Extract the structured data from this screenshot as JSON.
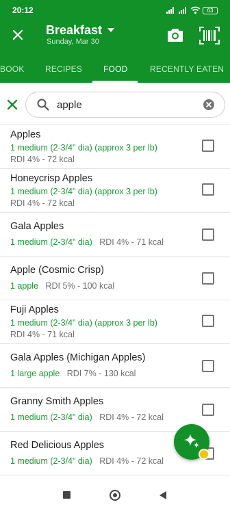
{
  "status_bar": {
    "time": "20:12",
    "battery": "63"
  },
  "header": {
    "title": "Breakfast",
    "date": "Sunday, Mar 30"
  },
  "tabs": [
    {
      "label": "BOOK"
    },
    {
      "label": "RECIPES"
    },
    {
      "label": "FOOD",
      "active": true
    },
    {
      "label": "RECENTLY EATEN"
    }
  ],
  "search": {
    "value": "apple"
  },
  "results": [
    {
      "name": "Apples",
      "serving": "1 medium (2-3/4\" dia) (approx 3 per lb)",
      "nutrition": "RDI 4% - 72 kcal"
    },
    {
      "name": "Honeycrisp Apples",
      "serving": "1 medium  (2-3/4\" dia) (approx 3 per lb)",
      "nutrition": "RDI 4% - 72 kcal"
    },
    {
      "name": "Gala Apples",
      "serving": "1 medium  (2-3/4\" dia)",
      "nutrition": "RDI 4% - 71 kcal"
    },
    {
      "name": "Apple (Cosmic Crisp)",
      "serving": "1 apple",
      "nutrition": "RDI 5% - 100 kcal"
    },
    {
      "name": "Fuji Apples",
      "serving": "1 medium  (2-3/4\" dia) (approx 3 per lb)",
      "nutrition": "RDI 4% - 71 kcal"
    },
    {
      "name": "Gala Apples (Michigan Apples)",
      "serving": "1 large apple",
      "nutrition": "RDI 7% - 130 kcal"
    },
    {
      "name": "Granny Smith Apples",
      "serving": "1 medium  (2-3/4\" dia)",
      "nutrition": "RDI 4% - 72 kcal"
    },
    {
      "name": "Red Delicious Apples",
      "serving": "1 medium  (2-3/4\" dia)",
      "nutrition": "RDI 4% - 72 kcal"
    }
  ],
  "colors": {
    "brand_green": "#119128",
    "serving_green": "#1b9a35",
    "badge_yellow": "#f2c500"
  }
}
